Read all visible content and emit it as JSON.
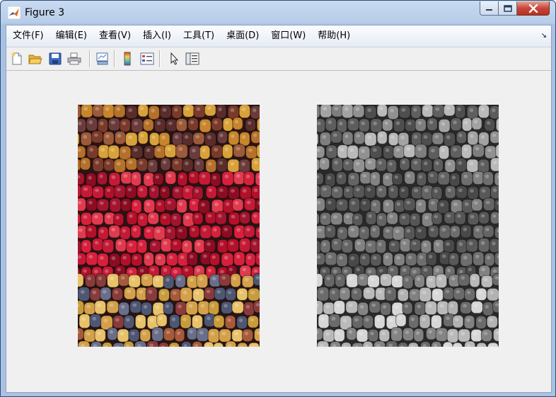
{
  "window": {
    "title": "Figure 3"
  },
  "menu": {
    "items": [
      {
        "label": "文件(F)"
      },
      {
        "label": "编辑(E)"
      },
      {
        "label": "查看(V)"
      },
      {
        "label": "插入(I)"
      },
      {
        "label": "工具(T)"
      },
      {
        "label": "桌面(D)"
      },
      {
        "label": "窗口(W)"
      },
      {
        "label": "帮助(H)"
      }
    ],
    "overflow_icon": "dock-arrow-icon"
  },
  "toolbar": {
    "buttons": [
      {
        "icon": "new-figure-icon"
      },
      {
        "icon": "open-file-icon"
      },
      {
        "icon": "save-icon"
      },
      {
        "icon": "print-icon"
      },
      {
        "icon": "link-plot-icon"
      },
      {
        "icon": "insert-colorbar-icon"
      },
      {
        "icon": "insert-legend-icon"
      },
      {
        "icon": "pointer-icon"
      },
      {
        "icon": "property-inspector-icon"
      }
    ]
  },
  "figure": {
    "images": [
      {
        "kind": "color",
        "content": "corn"
      },
      {
        "kind": "grayscale",
        "content": "corn"
      }
    ]
  }
}
